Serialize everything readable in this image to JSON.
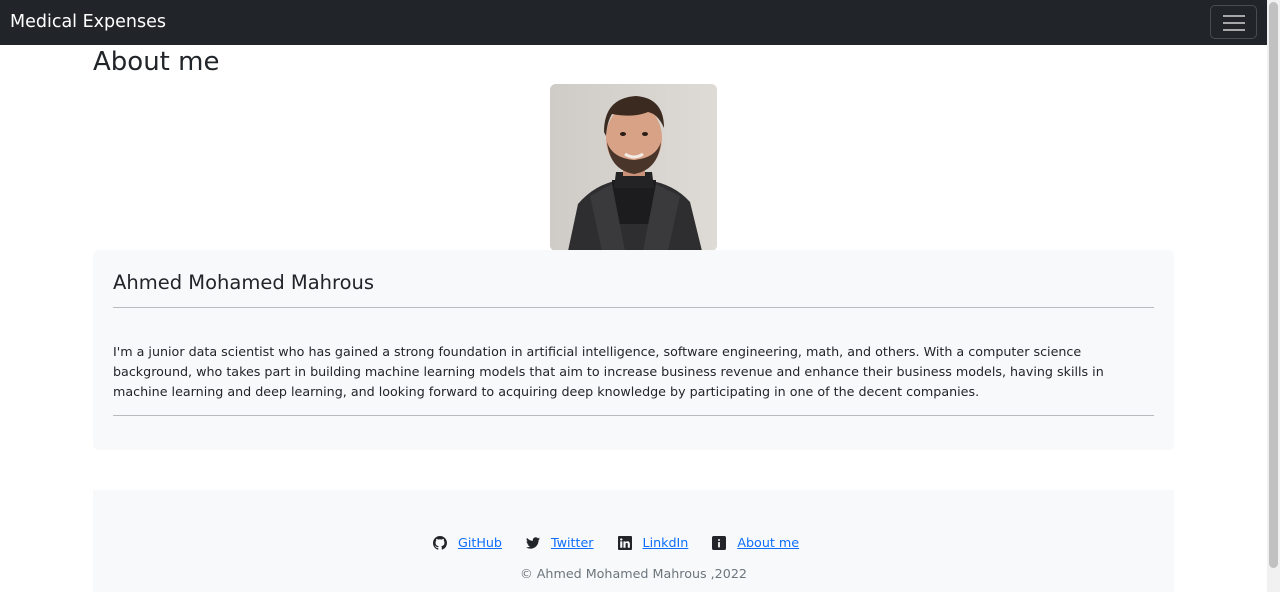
{
  "navbar": {
    "brand": "Medical Expenses",
    "toggler_icon": "hamburger-menu-icon"
  },
  "page": {
    "title": "About me"
  },
  "profile": {
    "photo_alt": "Ahmed Mohamed Mahrous",
    "name": "Ahmed Mohamed Mahrous",
    "bio": "I'm a junior data scientist who has gained a strong foundation in artificial intelligence, software engineering, math, and others. With a computer science background, who takes part in building machine learning models that aim to increase business revenue and enhance their business models, having skills in machine learning and deep learning, and looking forward to acquiring deep knowledge by participating in one of the decent companies."
  },
  "footer": {
    "links": [
      {
        "label": "GitHub",
        "icon": "github-icon"
      },
      {
        "label": "Twitter",
        "icon": "twitter-icon"
      },
      {
        "label": "LinkdIn",
        "icon": "linkedin-icon"
      },
      {
        "label": "About me",
        "icon": "info-icon"
      }
    ],
    "copyright": "© Ahmed Mohamed Mahrous ,2022"
  },
  "colors": {
    "navbar_bg": "#212529",
    "panel_bg": "#f8f9fa",
    "link": "#0d6efd",
    "muted_text": "#6c757d"
  }
}
